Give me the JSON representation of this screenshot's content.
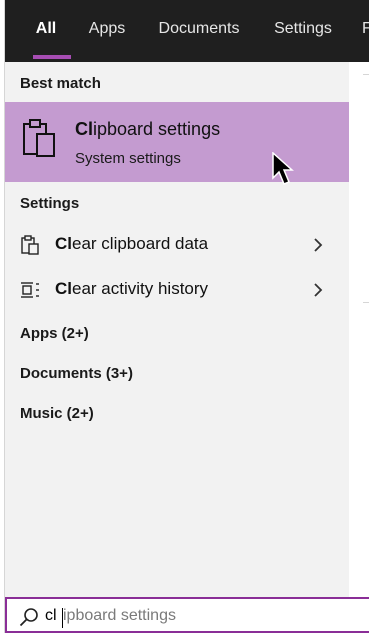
{
  "tabs": [
    {
      "label": "All",
      "active": true
    },
    {
      "label": "Apps",
      "active": false
    },
    {
      "label": "Documents",
      "active": false
    },
    {
      "label": "Settings",
      "active": false
    },
    {
      "label": "F",
      "active": false
    }
  ],
  "sections": {
    "best_match_label": "Best match",
    "settings_label": "Settings"
  },
  "best_match": {
    "title_bold": "Cl",
    "title_rest": "ipboard settings",
    "subtitle": "System settings",
    "icon": "clipboard-icon"
  },
  "settings_results": [
    {
      "label_bold": "Cl",
      "label_rest": "ear clipboard data",
      "icon": "clipboard-clear-icon"
    },
    {
      "label_bold": "Cl",
      "label_rest": "ear activity history",
      "icon": "activity-history-icon"
    }
  ],
  "categories": [
    {
      "label": "Apps (2+)"
    },
    {
      "label": "Documents (3+)"
    },
    {
      "label": "Music (2+)"
    }
  ],
  "search": {
    "typed": "cl",
    "suggestion_rest": "ipboard settings"
  },
  "colors": {
    "tab_bar": "#1f1f1f",
    "accent": "#a64db3",
    "highlight": "#c49bd0",
    "search_border": "#8a2e97"
  }
}
